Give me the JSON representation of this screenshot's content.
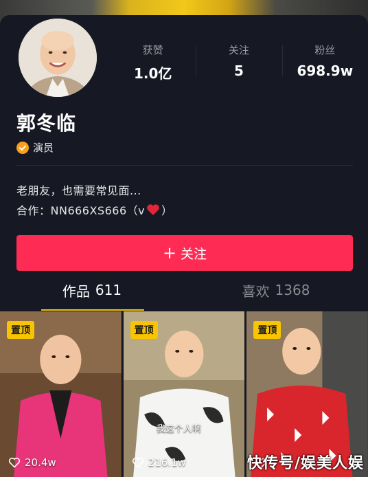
{
  "profile": {
    "name": "郭冬临",
    "verification": "演员",
    "bio": "老朋友，也需要常见面...",
    "collab_prefix": "合作：NN666XS666（v",
    "collab_suffix": "）"
  },
  "stats": [
    {
      "label": "获赞",
      "value": "1.0亿"
    },
    {
      "label": "关注",
      "value": "5"
    },
    {
      "label": "粉丝",
      "value": "698.9w"
    }
  ],
  "follow_button": {
    "icon": "plus-icon",
    "label": "关注"
  },
  "tabs": [
    {
      "label": "作品",
      "count": "611",
      "active": true
    },
    {
      "label": "喜欢",
      "count": "1368",
      "active": false
    }
  ],
  "videos": [
    {
      "pin": "置顶",
      "likes": "20.4w",
      "caption": ""
    },
    {
      "pin": "置顶",
      "likes": "216.1w",
      "caption": "我这个人啊"
    },
    {
      "pin": "置顶",
      "likes": "",
      "caption": ""
    }
  ],
  "watermark": "快传号/娱美人娱",
  "colors": {
    "accent": "#fe2c55",
    "pin": "#f9c400",
    "background": "#161823"
  }
}
